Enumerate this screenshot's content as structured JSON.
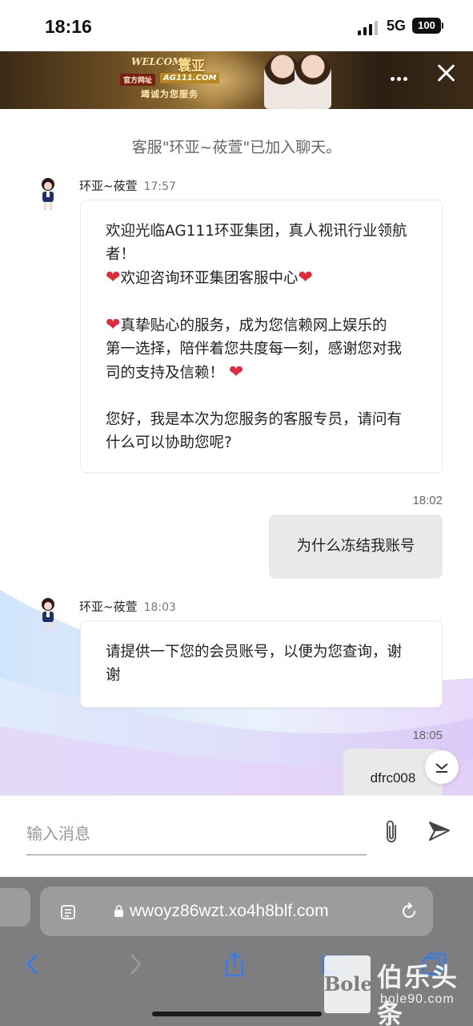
{
  "status_bar": {
    "time": "18:16",
    "network": "5G",
    "battery": "100"
  },
  "banner": {
    "welcome": "WELCOME",
    "brand": "寰亚",
    "official_label": "官方网址",
    "url": "AG111.COM",
    "slogan": "竭诚为您服务"
  },
  "chat": {
    "system_message": "客服\"环亚~莜萱\"已加入聊天。",
    "messages": [
      {
        "sender": "环亚~莜萱",
        "time": "17:57",
        "lines": [
          "欢迎光临AG111环亚集团，真人视讯行业领航",
          "者！",
          "欢迎咨询环亚集团客服中心",
          "",
          "真挚贴心的服务，成为您信赖网上娱乐的",
          "第一选择，陪伴着您共度每一刻，感谢您对我",
          "司的支持及信赖！",
          "",
          "您好，我是本次为您服务的客服专员，请问有",
          "什么可以协助您呢?"
        ]
      },
      {
        "time": "18:02",
        "text": "为什么冻结我账号"
      },
      {
        "sender": "环亚~莜萱",
        "time": "18:03",
        "lines": [
          "请提供一下您的会员账号，以便为您查询，谢",
          "谢"
        ]
      },
      {
        "time": "18:05",
        "text": "dfrc008"
      }
    ]
  },
  "input": {
    "placeholder": "输入消息"
  },
  "browser": {
    "url": "wwoyz86wzt.xo4h8blf.com"
  },
  "watermark": {
    "logo": "Bole",
    "title": "伯乐头条",
    "sub": "bole90.com"
  },
  "colors": {
    "heart": "#e02b3c",
    "outgoing_bubble": "#e9e9e9",
    "safari_bar": "#7e7e80",
    "ios_blue": "#2f7cf6"
  },
  "icons": [
    "signal-icon",
    "more-icon",
    "close-icon",
    "heart-icon",
    "scroll-down-icon",
    "attach-icon",
    "send-icon",
    "reader-icon",
    "lock-icon",
    "reload-icon",
    "back-icon",
    "forward-icon",
    "share-icon",
    "bookmarks-icon",
    "tabs-icon"
  ]
}
